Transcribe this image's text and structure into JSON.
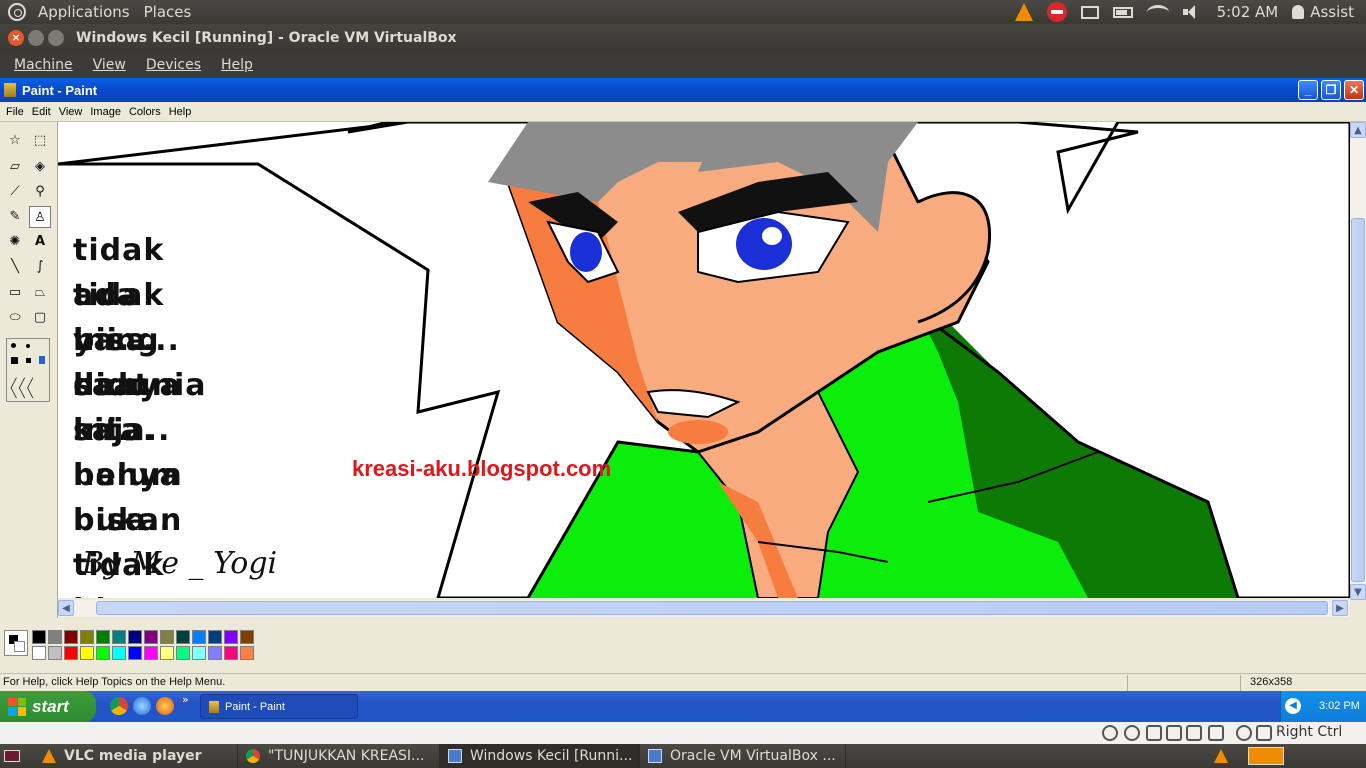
{
  "top_panel": {
    "menus": [
      "Applications",
      "Places"
    ],
    "time": "5:02 AM",
    "user": "Assist"
  },
  "vbox": {
    "title": "Windows Kecil [Running] - Oracle VM VirtualBox",
    "menu": [
      "Machine",
      "View",
      "Devices",
      "Help"
    ],
    "host_key": "Right Ctrl"
  },
  "paint": {
    "title": "Paint - Paint",
    "menu": [
      "File",
      "Edit",
      "View",
      "Image",
      "Colors",
      "Help"
    ],
    "status_help": "For Help, click Help Topics on the Help Menu.",
    "status_size": "326x358",
    "palette": [
      "#000000",
      "#808080",
      "#800000",
      "#808000",
      "#008000",
      "#008080",
      "#000080",
      "#800080",
      "#808040",
      "#004040",
      "#0080ff",
      "#004080",
      "#8000ff",
      "#804000",
      "#ffffff",
      "#c0c0c0",
      "#ff0000",
      "#ffff00",
      "#00ff00",
      "#00ffff",
      "#0000ff",
      "#ff00ff",
      "#ffff80",
      "#00ff80",
      "#80ffff",
      "#8080ff",
      "#ff0080",
      "#ff8040"
    ]
  },
  "drawing": {
    "lines": [
      "tidak ada yang",
      "tidak bisa didunia",
      "ini..... hanya saja..",
      "saat ini...",
      "kita hanya",
      "belum bisa..",
      "bukan tidak bisa..."
    ],
    "watermark": "kreasi-aku.blogspot.com",
    "signature": "By Me _ Yogi"
  },
  "xp_taskbar": {
    "start": "start",
    "task": "Paint - Paint",
    "time": "3:02 PM"
  },
  "bottom_panel": {
    "tasks": [
      "VLC media player",
      "\"TUNJUKKAN KREASI...",
      "Windows Kecil [Runni...",
      "Oracle VM VirtualBox ..."
    ]
  },
  "colors": {
    "xp_blue": "#0a5de5",
    "ubuntu_panel": "#3c3b37",
    "watermark_red": "#e0161b"
  }
}
